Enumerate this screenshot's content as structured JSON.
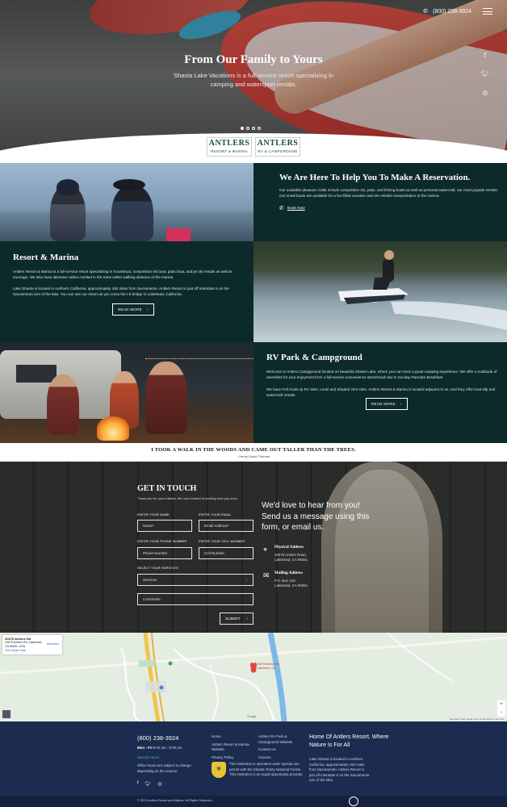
{
  "header": {
    "phone": "(800) 238-3924"
  },
  "hero": {
    "title": "From Our Family to Yours",
    "subtitle": "Shasta Lake Vacations is a full-service resort specializing in camping and watersport rentals."
  },
  "logos": [
    {
      "name": "ANTLERS",
      "sub": "RESORT & MARINA"
    },
    {
      "name": "ANTLERS",
      "sub": "RV & CAMPGROUND"
    }
  ],
  "reservation": {
    "title": "We Are Here To Help You To Make A Reservation.",
    "text": "Our available pleasure crafts include competition ski, patio, and fishing boats as well as personal watercraft, our most popular rentals. Our small boats are available for a fun-filled vacation and are reliable transportation to the marina.",
    "cta": "Book Now"
  },
  "resort": {
    "title": "Resort & Marina",
    "text1": "Antlers Resort & Marina is a full-service resort specializing in houseboat, competition ski boat, patio boat, and jet ski rentals as well as moorage. We also have lakeview cabins nestled in the trees within walking distance of the marina.",
    "text2": "Lake Shasta is located in northern California, approximately 160 miles from Sacramento. Antlers Resort is just off Interstate 5 on the Sacramento arm of the lake. You can see our resort as you cross the I-5 bridge in Lakehead, California.",
    "cta": "READ MORE"
  },
  "rv": {
    "title": "RV Park & Campground",
    "text1": "Welcome to Antlers Campground located on beautiful Shasta Lake, where you can have a great camping experience. We offer a multitude of amenities for your enjoyment from a full-service convenience store/snack bar to Sunday Pancake Breakfast.",
    "text2": "We have Full Hook-up RV sites, Level and Shaded Tent sites. Antlers Resort & Marina is located adjacent to us, and they offer boat slip and watercraft rentals.",
    "cta": "READ MORE"
  },
  "quote": {
    "text": "I TOOK A WALK IN THE WOODS AND CAME OUT TALLER THAN THE TREES.",
    "author": "- Henry David Thoreau"
  },
  "contact": {
    "title": "GET IN TOUCH",
    "subtitle": "Thank you for your interest. We look forward to hearing from you soon.",
    "name_label": "ENTER YOUR NAME",
    "name_placeholder": "Name*",
    "email_label": "ENTER YOUR EMAIL",
    "email_placeholder": "Email Address*",
    "phone_label": "ENTER YOUR PHONE NUMBER",
    "phone_placeholder": "Phone Number",
    "cell_label": "ENTER YOUR CELL NUMBER",
    "cell_placeholder": "Cell Number",
    "services_label": "SELECT YOUR SERVICES",
    "services_value": "Services",
    "comments_placeholder": "Comments",
    "submit": "SUBMIT",
    "message": "We'd love to hear from you! Send us a message using this form, or email us.",
    "physical_title": "Physical Address",
    "physical_line1": "20679 Antlers Road,",
    "physical_line2": "Lakehead, CA 96051",
    "mailing_title": "Mailing Address",
    "mailing_line1": "P.O. Box 140",
    "mailing_line2": "Lakehead, CA 96051"
  },
  "map": {
    "card_title": "20679 Antlers Rd",
    "card_line": "20679 Antlers Rd, Lakehead, CA 96051, USA",
    "card_link": "View larger map",
    "directions": "Directions",
    "pin_label": "20679 Antlers Rd, Lakehead, CA",
    "zoom_in": "+",
    "zoom_out": "−",
    "google": "Google",
    "attribution": "Map data ©2021 Google   Terms of Use   Report a map error"
  },
  "footer": {
    "phone": "(800) 238-3924",
    "hours_day": "Mon - Fri",
    "hours": "8:00 am - 5:00 pm",
    "special_hours": "Special Hours",
    "hours_note": "Office hours are subject to change depending on the season.",
    "links_col1": [
      "Home",
      "Antlers Resort & Marina Website",
      "Privacy Policy"
    ],
    "links_col2": [
      "Antlers RV Park & Campground Website",
      "Contact Us",
      "Careers"
    ],
    "forest_text": "This institution is operated under special use permit with the Shasta-Trinity National Forest. This institution is an equal opportunity provider.",
    "home_title": "Home Of Antlers Resort, Where Nature Is For All",
    "home_text": "Lake Shasta is located in northern California, approximately 160 miles from Sacramento. Antlers Resort is just off Interstate 5 on the Sacramento arm of the lake.",
    "copyright": "© 2021 Antlers Resort and Marina. All Rights Reserved."
  },
  "colors": {
    "dark_teal": "#0d2a2a",
    "footer_navy": "#1c2c50",
    "accent_teal": "#3db3a6"
  }
}
